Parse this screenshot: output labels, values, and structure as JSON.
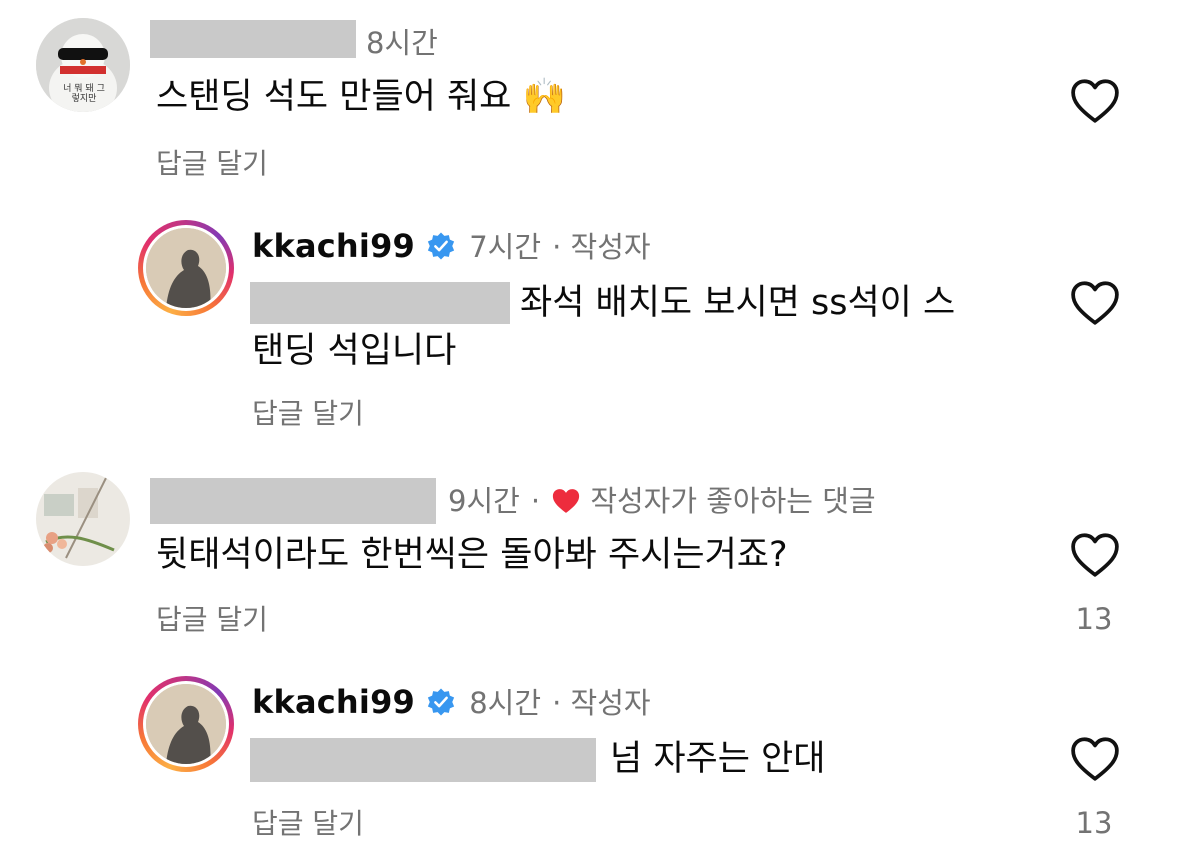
{
  "comments": [
    {
      "time": "8시간",
      "text": "스탠딩 석도 만들어 줘요",
      "emoji": "🙌",
      "reply_label": "답글 달기",
      "avatar_caption": "너 뭐 돼 그렇지만",
      "replies": [
        {
          "username": "kkachi99",
          "time": "7시간",
          "meta": "· 작성자",
          "text_line1": "좌석 배치도 보시면 ss석이 스",
          "text_line2": "탠딩 석입니다",
          "reply_label": "답글 달기"
        }
      ]
    },
    {
      "time": "9시간",
      "meta": "·",
      "liked_label": "작성자가 좋아하는 댓글",
      "text": "뒷태석이라도 한번씩은 돌아봐 주시는거죠?",
      "reply_label": "답글 달기",
      "like_count": "13",
      "replies": [
        {
          "username": "kkachi99",
          "time": "8시간",
          "meta": "· 작성자",
          "text": "넘 자주는 안대",
          "reply_label": "답글 달기",
          "like_count": "13"
        }
      ]
    }
  ],
  "icons": {
    "heart": "heart-outline-icon",
    "liked_heart": "heart-filled-icon",
    "verified": "verified-badge-icon"
  },
  "colors": {
    "liked_heart": "#ed2c3d",
    "verified": "#3897f0",
    "meta": "#737373"
  }
}
